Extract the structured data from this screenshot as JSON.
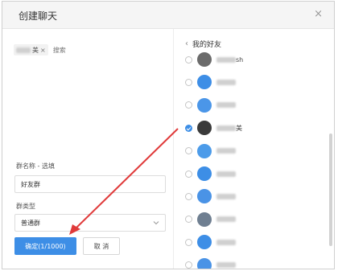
{
  "dialog": {
    "title": "创建聊天",
    "close_glyph": "×"
  },
  "left": {
    "selected_chip": {
      "suffix": "美",
      "remove_glyph": "×"
    },
    "search_placeholder": "搜索",
    "group_name_label": "群名称 - 选填",
    "group_name_value": "好友群",
    "group_type_label": "群类型",
    "group_type_value": "普通群",
    "confirm_label": "确定(1/1000)",
    "cancel_label": "取 消"
  },
  "right": {
    "back_glyph": "‹",
    "header": "我的好友",
    "friends": [
      {
        "avatar_color": "#6b6b6b",
        "checked": false,
        "suffix": "sh"
      },
      {
        "avatar_color": "#3d8ee6",
        "checked": false,
        "suffix": ""
      },
      {
        "avatar_color": "#4b96e8",
        "checked": false,
        "suffix": ""
      },
      {
        "avatar_color": "#3a3a3a",
        "checked": true,
        "suffix": "美"
      },
      {
        "avatar_color": "#4c9be9",
        "checked": false,
        "suffix": ""
      },
      {
        "avatar_color": "#3d8ee6",
        "checked": false,
        "suffix": ""
      },
      {
        "avatar_color": "#4a93e6",
        "checked": false,
        "suffix": ""
      },
      {
        "avatar_color": "#6f7f91",
        "checked": false,
        "suffix": ""
      },
      {
        "avatar_color": "#3d8ee6",
        "checked": false,
        "suffix": ""
      },
      {
        "avatar_color": "#4a93e6",
        "checked": false,
        "suffix": ""
      }
    ]
  },
  "colors": {
    "accent": "#3d8ee6",
    "annotation_arrow": "#e03a3a"
  }
}
